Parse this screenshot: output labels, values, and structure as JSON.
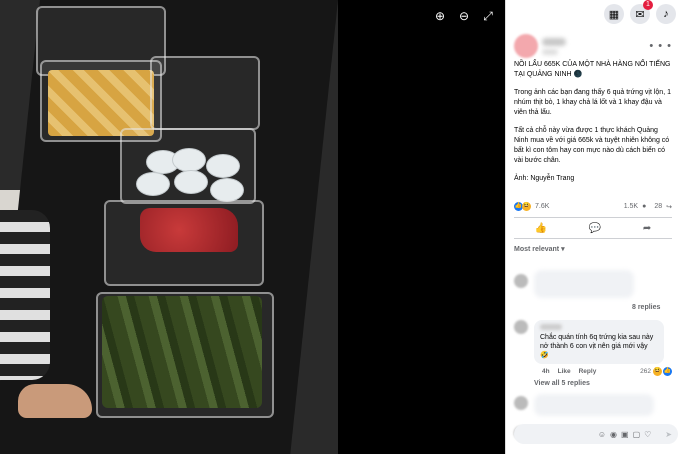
{
  "viewer": {
    "zoom_in": "⊕",
    "zoom_out": "⊖",
    "fullscreen": "⤢"
  },
  "topbar": {
    "menu_icon": "▦",
    "messenger_icon": "✉",
    "notification_badge": "1",
    "notifications_icon": "♪"
  },
  "post": {
    "more": "• • •",
    "paragraphs": [
      "NỒI LẨU 665K CỦA MỘT NHÀ HÀNG NỔI TIẾNG TẠI QUẢNG NINH 🌑",
      "Trong ảnh các bạn đang thấy 6 quả trứng vịt lộn, 1 nhúm thịt bò, 1 khay chả lá lốt và 1 khay đậu và viên thả lẩu.",
      "Tất cả chỗ này vừa được 1 thực khách Quảng Ninh mua về với giá 665k và tuyệt nhiên không có bất kì con tôm hay con mực nào dù cách biển có vài bước chân.",
      "Ảnh: Nguyễn Trang"
    ],
    "reactions_count": "7.6K",
    "comments_count": "1.5K",
    "comment_icon": "●",
    "shares_count": "28",
    "share_icon": "↪"
  },
  "actions": {
    "like": "👍",
    "comment": "💬",
    "share": "➦"
  },
  "comments": {
    "sort_label": "Most relevant ▾",
    "replies_link": "8 replies",
    "reply_text": "Chắc quán tính 6q trứng kia sau này nở thành 6 con vịt nên giá mới vậy 🤣",
    "reply_time": "4h",
    "reply_like": "Like",
    "reply_reply": "Reply",
    "reply_count": "262",
    "view_all": "View all 5 replies"
  },
  "composer": {
    "icons": [
      "☺",
      "◉",
      "▣",
      "▢",
      "♡"
    ],
    "send": "➤"
  }
}
